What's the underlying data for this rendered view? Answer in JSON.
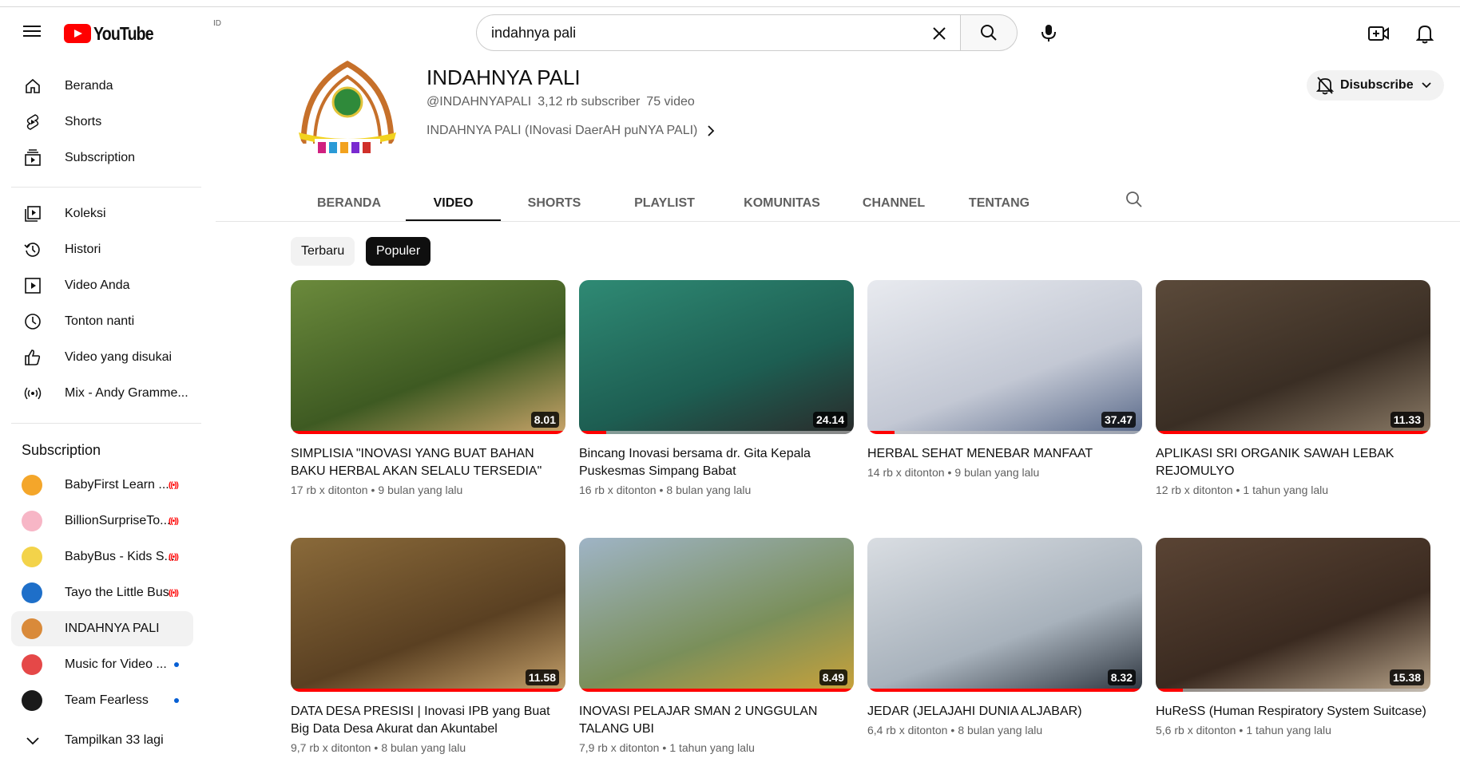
{
  "masthead": {
    "logo_text": "YouTube",
    "country_code": "ID",
    "search_value": "indahnya pali"
  },
  "sidebar": {
    "main": [
      {
        "label": "Beranda",
        "icon": "home-icon"
      },
      {
        "label": "Shorts",
        "icon": "shorts-icon"
      },
      {
        "label": "Subscription",
        "icon": "subscriptions-icon"
      }
    ],
    "library": [
      {
        "label": "Koleksi",
        "icon": "library-icon"
      },
      {
        "label": "Histori",
        "icon": "history-icon"
      },
      {
        "label": "Video Anda",
        "icon": "your-videos-icon"
      },
      {
        "label": "Tonton nanti",
        "icon": "watch-later-icon"
      },
      {
        "label": "Video yang disukai",
        "icon": "liked-icon"
      },
      {
        "label": "Mix - Andy Gramme...",
        "icon": "mix-icon"
      }
    ],
    "subscriptions_heading": "Subscription",
    "subscriptions": [
      {
        "label": "BabyFirst Learn ...",
        "status": "live",
        "color": "#f4a62a"
      },
      {
        "label": "BillionSurpriseTo...",
        "status": "live",
        "color": "#f7b6c6"
      },
      {
        "label": "BabyBus - Kids S...",
        "status": "live",
        "color": "#f3d34a"
      },
      {
        "label": "Tayo the Little Bus",
        "status": "live",
        "color": "#1e6fc9"
      },
      {
        "label": "INDAHNYA PALI",
        "status": "none",
        "color": "#d98a3a"
      },
      {
        "label": "Music for Video ...",
        "status": "new",
        "color": "#e54848"
      },
      {
        "label": "Team Fearless",
        "status": "new",
        "color": "#1a1a1a"
      }
    ],
    "show_more": "Tampilkan 33 lagi",
    "live_glyph": "((•))"
  },
  "channel": {
    "name": "INDAHNYA PALI",
    "handle": "@INDAHNYAPALI",
    "subscribers": "3,12 rb subscriber",
    "videos": "75 video",
    "description": "INDAHNYA PALI (INovasi DaerAH puNYA PALI)",
    "unsubscribe_label": "Disubscribe"
  },
  "tabs": [
    "BERANDA",
    "VIDEO",
    "SHORTS",
    "PLAYLIST",
    "KOMUNITAS",
    "CHANNEL",
    "TENTANG"
  ],
  "active_tab": "VIDEO",
  "chips": {
    "latest": "Terbaru",
    "popular": "Populer"
  },
  "videos": [
    {
      "title": "SIMPLISIA \"INOVASI YANG BUAT BAHAN BAKU HERBAL AKAN SELALU TERSEDIA\"",
      "duration": "8.01",
      "views": "17 rb x ditonton",
      "age": "9 bulan yang lalu",
      "progress": 1.0,
      "palette": [
        "#6b8a3c",
        "#3e5a22",
        "#c9a46a"
      ]
    },
    {
      "title": "Bincang Inovasi bersama dr. Gita Kepala Puskesmas Simpang Babat",
      "duration": "24.14",
      "views": "16 rb x ditonton",
      "age": "8 bulan yang lalu",
      "progress": 0.1,
      "palette": [
        "#2f8a74",
        "#1d5e52",
        "#2a2a2a"
      ]
    },
    {
      "title": "HERBAL SEHAT MENEBAR MANFAAT",
      "duration": "37.47",
      "views": "14 rb x ditonton",
      "age": "9 bulan yang lalu",
      "progress": 0.1,
      "palette": [
        "#e8eaef",
        "#c3c8d4",
        "#5a6a8a"
      ]
    },
    {
      "title": "APLIKASI SRI ORGANIK SAWAH LEBAK REJOMULYO",
      "duration": "11.33",
      "views": "12 rb x ditonton",
      "age": "1 tahun yang lalu",
      "progress": 1.0,
      "palette": [
        "#5b4a3a",
        "#3a2e24",
        "#8a7a66"
      ]
    },
    {
      "title": "DATA DESA PRESISI | Inovasi IPB yang Buat Big Data Desa Akurat dan Akuntabel",
      "duration": "11.58",
      "views": "9,7 rb x ditonton",
      "age": "8 bulan yang lalu",
      "progress": 1.0,
      "palette": [
        "#8a6a3a",
        "#5a4022",
        "#c4a06a"
      ]
    },
    {
      "title": "INOVASI PELAJAR SMAN 2 UNGGULAN TALANG UBI",
      "duration": "8.49",
      "views": "7,9 rb x ditonton",
      "age": "1 tahun yang lalu",
      "progress": 1.0,
      "palette": [
        "#9fb4c6",
        "#7a8f5a",
        "#c9a23a"
      ]
    },
    {
      "title": "JEDAR (JELAJAHI DUNIA ALJABAR)",
      "duration": "8.32",
      "views": "6,4 rb x ditonton",
      "age": "8 bulan yang lalu",
      "progress": 1.0,
      "palette": [
        "#d9dde2",
        "#a8b2bc",
        "#2e3640"
      ]
    },
    {
      "title": "HuReSS (Human Respiratory System Suitcase)",
      "duration": "15.38",
      "views": "5,6 rb x ditonton",
      "age": "1 tahun yang lalu",
      "progress": 0.1,
      "palette": [
        "#5a4434",
        "#3a2a20",
        "#b8a48a"
      ]
    }
  ],
  "meta_separator": "•",
  "colors": {
    "brand_red": "#ff0000",
    "live_red": "#ff0000",
    "new_dot": "#065fd4"
  }
}
